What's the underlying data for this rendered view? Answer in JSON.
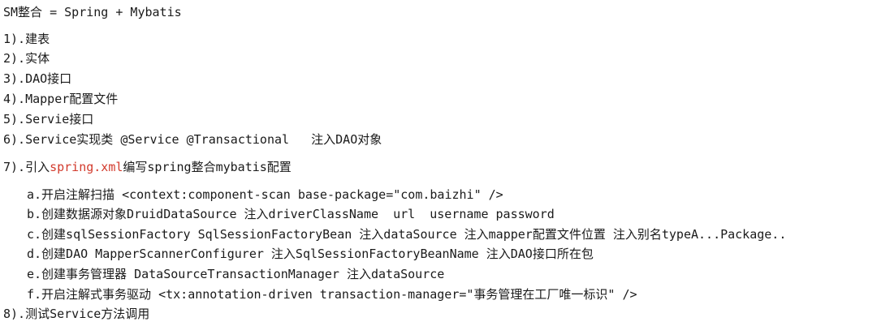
{
  "title": "SM整合 = Spring + Mybatis",
  "steps": [
    {
      "text": "1).建表"
    },
    {
      "text": "2).实体"
    },
    {
      "text": "3).DAO接口"
    },
    {
      "text": "4).Mapper配置文件"
    },
    {
      "text": "5).Servie接口"
    },
    {
      "text": "6).Service实现类 @Service @Transactional   注入DAO对象"
    },
    {
      "prefix": "7).引入",
      "highlight": "spring.xml",
      "suffix": "编写spring整合mybatis配置"
    },
    {
      "text": "8).测试Service方法调用"
    }
  ],
  "substeps": [
    "a.开启注解扫描 <context:component-scan base-package=\"com.baizhi\" />",
    "b.创建数据源对象DruidDataSource 注入driverClassName  url  username password",
    "c.创建sqlSessionFactory SqlSessionFactoryBean 注入dataSource 注入mapper配置文件位置 注入别名typeA...Package..",
    "d.创建DAO MapperScannerConfigurer 注入SqlSessionFactoryBeanName 注入DAO接口所在包",
    "e.创建事务管理器 DataSourceTransactionManager 注入dataSource",
    "f.开启注解式事务驱动 <tx:annotation-driven transaction-manager=\"事务管理在工厂唯一标识\" />"
  ],
  "colors": {
    "text": "#1a1a1a",
    "highlight": "#d23a2c",
    "background": "#ffffff"
  }
}
